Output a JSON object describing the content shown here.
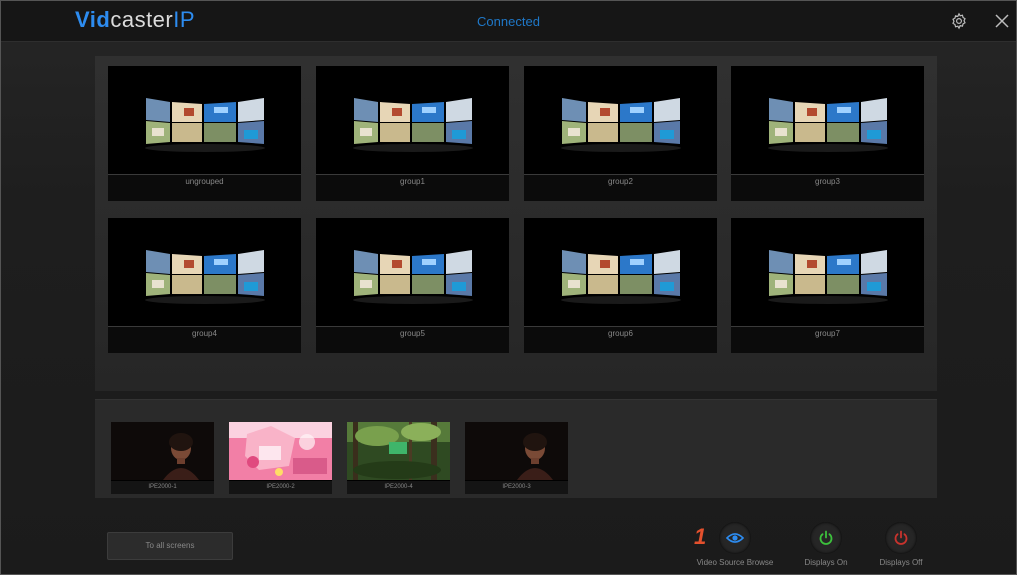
{
  "header": {
    "logo": {
      "vid": "Vid",
      "caster": "caster",
      "ip": "IP"
    },
    "status": "Connected",
    "settings_icon": "gear-icon",
    "close_icon": "close-icon"
  },
  "groups": [
    {
      "label": "ungrouped"
    },
    {
      "label": "group1"
    },
    {
      "label": "group2"
    },
    {
      "label": "group3"
    },
    {
      "label": "group4"
    },
    {
      "label": "group5"
    },
    {
      "label": "group6"
    },
    {
      "label": "group7"
    }
  ],
  "sources": [
    {
      "label": "IPE2000-1",
      "kind": "portrait"
    },
    {
      "label": "IPE2000-2",
      "kind": "pink-scene"
    },
    {
      "label": "IPE2000-4",
      "kind": "forest"
    },
    {
      "label": "IPE2000-3",
      "kind": "portrait"
    }
  ],
  "bottom": {
    "to_all_screens": "To all screens",
    "annotation": "1",
    "actions": [
      {
        "label": "Video Source Browse",
        "icon": "eye-icon",
        "color": "#2d8cf0"
      },
      {
        "label": "Displays On",
        "icon": "power-icon",
        "color": "#3cc13c"
      },
      {
        "label": "Displays Off",
        "icon": "power-icon",
        "color": "#c8332d"
      }
    ]
  },
  "colors": {
    "accent": "#2d8cf0",
    "on": "#3cc13c",
    "off": "#c8332d",
    "annotation": "#e3502d"
  }
}
